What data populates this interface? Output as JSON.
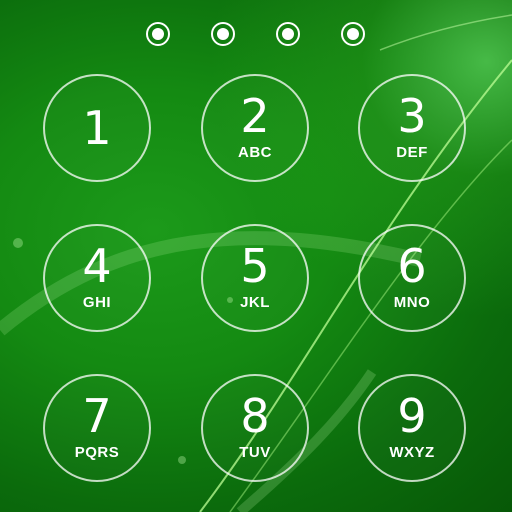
{
  "pin_indicator": {
    "entered_count": 4,
    "total": 4
  },
  "keypad": {
    "keys": [
      {
        "digit": "1",
        "letters": ""
      },
      {
        "digit": "2",
        "letters": "ABC"
      },
      {
        "digit": "3",
        "letters": "DEF"
      },
      {
        "digit": "4",
        "letters": "GHI"
      },
      {
        "digit": "5",
        "letters": "JKL"
      },
      {
        "digit": "6",
        "letters": "MNO"
      },
      {
        "digit": "7",
        "letters": "PQRS"
      },
      {
        "digit": "8",
        "letters": "TUV"
      },
      {
        "digit": "9",
        "letters": "WXYZ"
      }
    ]
  },
  "colors": {
    "background": "#148a12",
    "background_dark": "#075807",
    "highlight": "#7dff6a",
    "foreground": "#ffffff"
  }
}
